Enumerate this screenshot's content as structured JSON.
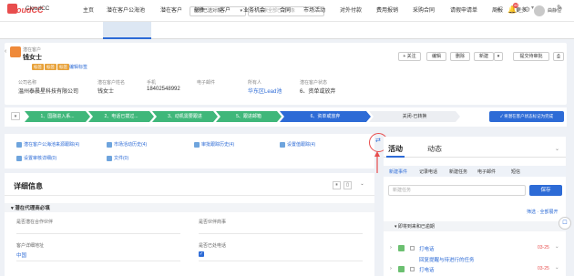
{
  "app": {
    "logo": "CloudCC",
    "name": "CloudCC"
  },
  "topbar": {
    "scope": "全部已选对象",
    "search_placeholder": "搜索全部已选对象",
    "badge": "44",
    "user": "曲静恒"
  },
  "nav": {
    "items": [
      "主页",
      "潜在客户公海池",
      "潜在客户",
      "邮件",
      "客户",
      "业务机会",
      "合同",
      "市场活动",
      "对外付款",
      "费用报销",
      "采购合同",
      "请假申请单",
      "周报",
      "更多"
    ],
    "active": "潜在客户公海池"
  },
  "record": {
    "type": "潜在客户",
    "name": "钱女士",
    "tags": [
      "标签",
      "标签",
      "标签"
    ],
    "edit_tags": "编辑标签",
    "buttons": {
      "follow": "+ 关注",
      "edit": "编辑",
      "delete": "删除",
      "new": "新建",
      "more": "▾",
      "submit": "提交待审批"
    },
    "fields": [
      {
        "label": "公司名称",
        "value": "温州泰晨星科技有限公司"
      },
      {
        "label": "潜在客户姓名",
        "value": "钱女士"
      },
      {
        "label": "手机",
        "value": "18402548992"
      },
      {
        "label": "电子邮件",
        "value": ""
      },
      {
        "label": "所有人",
        "value": "华东区Lead池"
      },
      {
        "label": "潜在客户状态",
        "value": "6、资单或放弃"
      }
    ]
  },
  "stages": {
    "items": [
      "1、国融进入系...",
      "2、电话已拨过...",
      "3、动机需要跟进",
      "5、跟进邮箱",
      "6、资单或放弃",
      "关闭-已转换"
    ],
    "button": "将潜在客户状态标记为完成"
  },
  "related": [
    "潜在客户公海池来源跟踪(4)",
    "市场活动历史(4)",
    "审批跟踪历史(4)",
    "设置值跟踪(4)",
    "设置审核详细(0)",
    "文件(0)"
  ],
  "detail": {
    "title": "详细信息",
    "section": "潜在代理商必填",
    "fields": [
      {
        "label": "是否潜在合作伙伴",
        "value": ""
      },
      {
        "label": "是否伙伴商事",
        "value": ""
      },
      {
        "label": "客户详细地址",
        "value": "中国"
      },
      {
        "label": "是否已处电话",
        "value": "✓"
      }
    ]
  },
  "activity": {
    "tabs": [
      "活动",
      "动态"
    ],
    "types": [
      "新建事件",
      "记录电话",
      "新建任务",
      "电子邮件",
      "短信"
    ],
    "input_placeholder": "新建任务",
    "save": "保存",
    "filter": "筛选 · 全部展开",
    "section": "即将到来和已逾期",
    "items": [
      {
        "title": "打电话",
        "sub": "",
        "date": "03-25"
      },
      {
        "title": "打电话",
        "sub": "回复提醒与待进行的任务",
        "date": "03-25"
      }
    ]
  },
  "colors": {
    "accent": "#2d6bd6",
    "stage_done": "#3fb77a",
    "stage_current": "#2d6bd6",
    "brand": "#e84d4d"
  }
}
